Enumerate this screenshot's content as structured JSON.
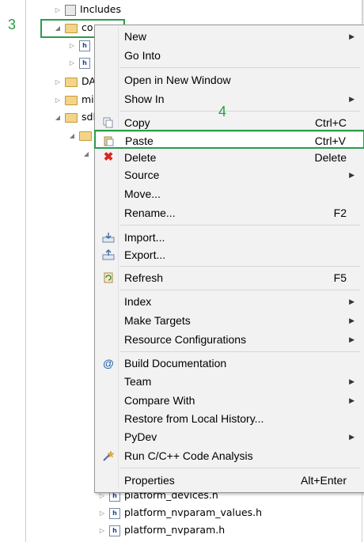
{
  "tree": {
    "includes_label": "Includes",
    "folder_co_label": "co",
    "folder_da_label": "DA",
    "folder_mi_label": "mi",
    "folder_sdl_label": "sdl",
    "file_icon_glyph": "h",
    "bottom_files": [
      "platform_devices.h",
      "platform_nvparam_values.h",
      "platform_nvparam.h"
    ]
  },
  "annotations": {
    "step3": "3",
    "step4": "4",
    "color": "#2a9d4a"
  },
  "menu": {
    "new": "New",
    "go_into": "Go Into",
    "open_new_window": "Open in New Window",
    "show_in": "Show In",
    "copy": "Copy",
    "copy_shortcut": "Ctrl+C",
    "paste": "Paste",
    "paste_shortcut": "Ctrl+V",
    "delete": "Delete",
    "delete_shortcut": "Delete",
    "source": "Source",
    "move": "Move...",
    "rename": "Rename...",
    "rename_shortcut": "F2",
    "import": "Import...",
    "export": "Export...",
    "refresh": "Refresh",
    "refresh_shortcut": "F5",
    "index": "Index",
    "make_targets": "Make Targets",
    "resource_configurations": "Resource Configurations",
    "build_documentation": "Build Documentation",
    "team": "Team",
    "compare_with": "Compare With",
    "restore_local_history": "Restore from Local History...",
    "pydev": "PyDev",
    "run_code_analysis": "Run C/C++ Code Analysis",
    "properties": "Properties",
    "properties_shortcut": "Alt+Enter"
  },
  "icons": {
    "submenu": "submenu-arrow-icon",
    "copy": "copy-icon",
    "paste": "paste-icon",
    "delete": "delete-x-icon",
    "import": "import-icon",
    "export": "export-icon",
    "refresh": "refresh-icon",
    "build_doc": "at-sign-icon",
    "code_analysis": "analysis-wand-icon"
  }
}
